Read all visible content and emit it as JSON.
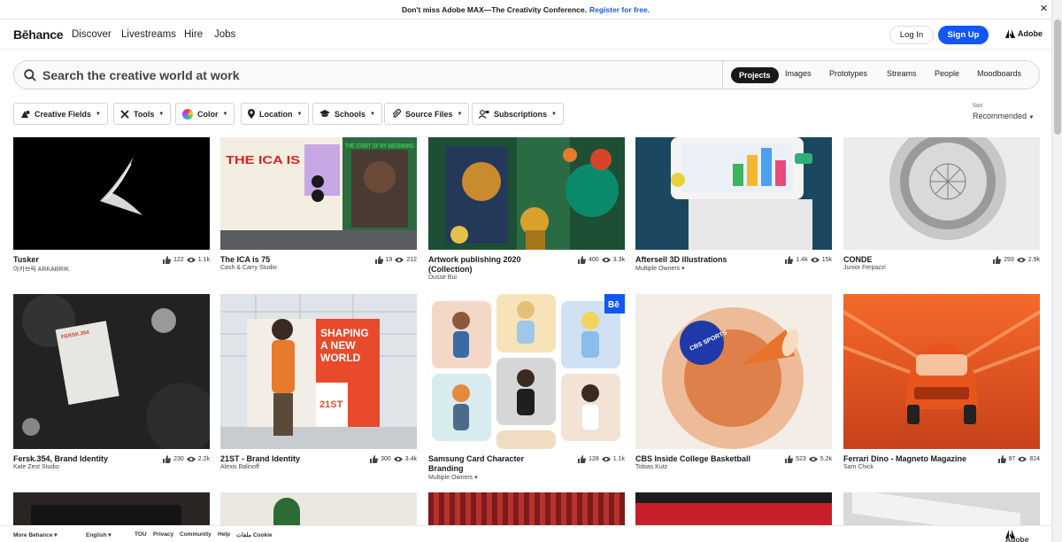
{
  "banner": {
    "text": "Don't miss Adobe MAX—The Creativity Conference.",
    "link": "Register for free."
  },
  "nav": {
    "logo": "Bēhance",
    "links": [
      "Discover",
      "Livestreams",
      "Hire",
      "Jobs"
    ],
    "login": "Log In",
    "signup": "Sign Up",
    "adobe": "Adobe"
  },
  "search": {
    "placeholder": "Search the creative world at work",
    "tabs": [
      "Projects",
      "Images",
      "Prototypes",
      "Streams",
      "People",
      "Moodboards"
    ],
    "active_tab": "Projects"
  },
  "filters": [
    "Creative Fields",
    "Tools",
    "Color",
    "Location",
    "Schools",
    "Source Files",
    "Subscriptions"
  ],
  "sort": {
    "label": "Sort",
    "value": "Recommended"
  },
  "projects": [
    {
      "title": "Tusker",
      "owner": "아카브릭 ARKABRIK",
      "likes": "122",
      "views": "1.1k"
    },
    {
      "title": "The ICA is 75",
      "owner": "Cash & Carry Studio",
      "likes": "19",
      "views": "212"
    },
    {
      "title": "Artwork publishing 2020 (Collection)",
      "owner": "Dusse Bui",
      "likes": "400",
      "views": "3.3k"
    },
    {
      "title": "Aftersell 3D illustrations",
      "owner": "Multiple Owners ▾",
      "likes": "1.4k",
      "views": "15k"
    },
    {
      "title": "CONDE",
      "owner": "Junior Ferpazzi",
      "likes": "293",
      "views": "2.9k"
    },
    {
      "title": "Fersk.354, Brand Identity",
      "owner": "Kate Zest Studio",
      "likes": "230",
      "views": "2.2k"
    },
    {
      "title": "21ST - Brand Identity",
      "owner": "Alexis Balinoff",
      "likes": "300",
      "views": "3.4k"
    },
    {
      "title": "Samsung Card Character Branding",
      "owner": "Multiple Owners ▾",
      "likes": "128",
      "views": "1.1k"
    },
    {
      "title": "CBS Inside College Basketball",
      "owner": "Tobias Kutz",
      "likes": "523",
      "views": "5.2k"
    },
    {
      "title": "Ferrari Dino - Magneto Magazine",
      "owner": "Sam Chick",
      "likes": "97",
      "views": "824"
    }
  ],
  "artwork": {
    "ica_poster": [
      "THE ICA IS",
      "THE START OF MY BEGINNING"
    ],
    "fersk": "FERSK.354",
    "billboard": [
      "SHAPING",
      "A NEW",
      "WORLD"
    ],
    "billboard_brand": "21ST",
    "behance_badge": "Bē",
    "cbs": "CBS SPORTS"
  },
  "footer": {
    "more": "More Behance ▾",
    "lang": "English ▾",
    "links": [
      "TOU",
      "Privacy",
      "Community",
      "Help",
      "ملفات Cookie"
    ],
    "adobe": "Adobe"
  }
}
